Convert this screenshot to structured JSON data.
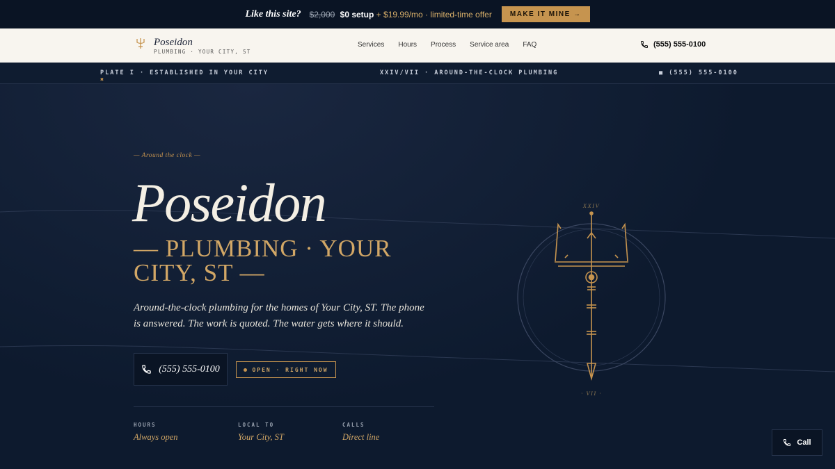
{
  "promo": {
    "lead": "Like this site?",
    "old_price": "$2,000",
    "setup": "$0 setup",
    "offer": "+ $19.99/mo · limited-time offer",
    "cta": "MAKE IT MINE →"
  },
  "nav": {
    "brand_name": "Poseidon",
    "brand_sub": "PLUMBING · YOUR CITY, ST",
    "links": [
      "Services",
      "Hours",
      "Process",
      "Service area",
      "FAQ"
    ],
    "phone": "(555) 555-0100"
  },
  "strip": {
    "left_mark": "✖",
    "left": "PLATE I · ESTABLISHED IN YOUR CITY",
    "center": "XXIV/VII · AROUND-THE-CLOCK PLUMBING",
    "right_mark": "■",
    "right": "(555) 555-0100"
  },
  "hero": {
    "kicker": "— Around the clock —",
    "title": "Poseidon",
    "subtitle": "— PLUMBING · YOUR CITY, ST —",
    "description": "Around-the-clock plumbing for the homes of Your City, ST. The phone is answered. The work is quoted. The water gets where it should.",
    "call_label": "(555) 555-0100",
    "open_label": "OPEN · RIGHT NOW",
    "stats": [
      {
        "label": "HOURS",
        "value": "Always open"
      },
      {
        "label": "LOCAL TO",
        "value": "Your City, ST"
      },
      {
        "label": "CALLS",
        "value": "Direct line"
      }
    ],
    "emblem_top": "XXIV",
    "emblem_bottom": "· VII ·"
  },
  "floating": {
    "call": "Call"
  },
  "colors": {
    "accent": "#c6944f",
    "navy": "#0d1a2e",
    "cream": "#f8f5ef"
  },
  "icons": [
    "trident-icon",
    "phone-icon"
  ]
}
